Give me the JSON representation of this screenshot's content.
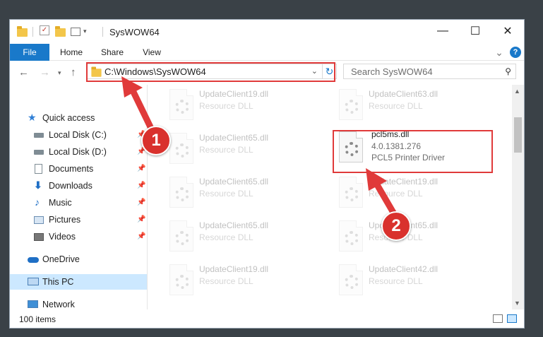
{
  "titlebar": {
    "title": "SysWOW64",
    "minimize": "—",
    "maximize": "☐",
    "close": "✕"
  },
  "ribbon": {
    "tabs": [
      "File",
      "Home",
      "Share",
      "View"
    ],
    "expand": "⌄",
    "help": "?"
  },
  "address": {
    "path": "C:\\Windows\\SysWOW64",
    "search_placeholder": "Search SysWOW64"
  },
  "nav": {
    "items": [
      {
        "label": "Quick access",
        "icon": "star-icon"
      },
      {
        "label": "Local Disk (C:)",
        "icon": "drive-icon"
      },
      {
        "label": "Local Disk (D:)",
        "icon": "drive-icon"
      },
      {
        "label": "Documents",
        "icon": "documents-icon"
      },
      {
        "label": "Downloads",
        "icon": "download-icon"
      },
      {
        "label": "Music",
        "icon": "music-icon"
      },
      {
        "label": "Pictures",
        "icon": "pictures-icon"
      },
      {
        "label": "Videos",
        "icon": "videos-icon"
      },
      {
        "label": "OneDrive",
        "icon": "cloud-icon"
      },
      {
        "label": "This PC",
        "icon": "computer-icon"
      },
      {
        "label": "Network",
        "icon": "network-icon"
      }
    ]
  },
  "files": {
    "left": [
      {
        "name": "UpdateClient19.dll",
        "type": "Resource DLL"
      },
      {
        "name": "UpdateClient65.dll",
        "type": "Resource DLL"
      },
      {
        "name": "UpdateClient65.dll",
        "type": "Resource DLL"
      },
      {
        "name": "UpdateClient65.dll",
        "type": "Resource DLL"
      },
      {
        "name": "UpdateClient19.dll",
        "type": "Resource DLL"
      }
    ],
    "right": [
      {
        "name": "UpdateClient63.dll",
        "type": "Resource DLL"
      },
      {
        "name": "UpdateClient19.dll",
        "type": "Resource DLL"
      },
      {
        "name": "UpdateClient65.dll",
        "type": "Resource DLL"
      },
      {
        "name": "UpdateClient42.dll",
        "type": "Resource DLL"
      }
    ],
    "highlighted": {
      "name": "pcl5ms.dll",
      "version": "4.0.1381.276",
      "description": "PCL5 Printer Driver"
    }
  },
  "status": {
    "count": "100 items"
  },
  "annotations": {
    "badge1": "1",
    "badge2": "2",
    "accent": "#e03a3a"
  }
}
